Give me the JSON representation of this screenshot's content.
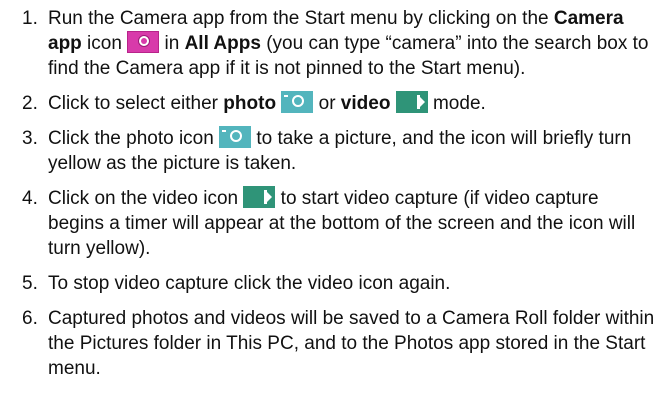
{
  "steps": [
    {
      "number": "1.",
      "t1": "Run the Camera app from the Start menu by clicking on the ",
      "b1": "Camera app",
      "t2": " icon ",
      "icon": "camera-app-icon",
      "t3": " in ",
      "b2": "All Apps",
      "t4": " (you can type “camera” into the search box to find the Camera app if it is not pinned to the Start menu)."
    },
    {
      "number": "2.",
      "t1": "Click to select either ",
      "b1": "photo",
      "icon1": "photo-mode-icon",
      "t2": " or ",
      "b2": "video",
      "icon2": "video-mode-icon",
      "t3": " mode."
    },
    {
      "number": "3.",
      "t1": "Click the photo icon ",
      "icon": "photo-mode-icon",
      "t2": " to take a picture, and the icon will briefly turn yellow as the picture is taken."
    },
    {
      "number": "4.",
      "t1": "Click on the video icon ",
      "icon": "video-mode-icon",
      "t2": " to start video capture (if video capture begins a timer will appear at the bottom of the screen and the icon will turn yellow)."
    },
    {
      "number": "5.",
      "t1": "To stop video capture click the video icon again."
    },
    {
      "number": "6.",
      "t1": "Captured photos and videos will be saved to a Camera Roll folder within the Pictures folder in This PC, and to the Photos app stored in the Start menu."
    }
  ],
  "colors": {
    "camera_app_tile": "#d83aaa",
    "photo_icon": "#53b5bd",
    "video_icon": "#2f9478"
  }
}
